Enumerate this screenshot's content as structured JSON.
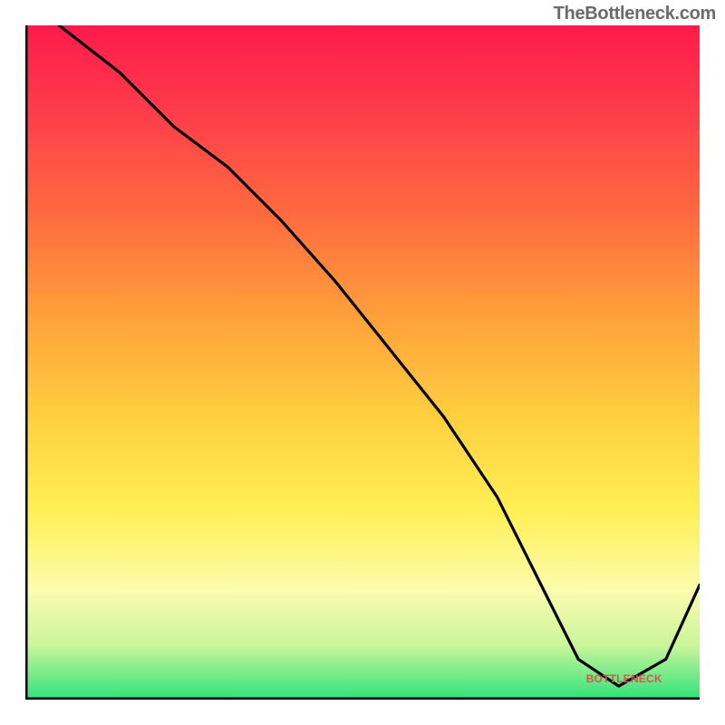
{
  "attribution": "TheBottleneck.com",
  "chart_data": {
    "type": "line",
    "title": "",
    "xlabel": "",
    "ylabel": "",
    "xlim": [
      0,
      100
    ],
    "ylim": [
      0,
      100
    ],
    "grid": false,
    "legend": false,
    "background_gradient_from_top": [
      "#ff1744",
      "#ff4d4d",
      "#ff8a3d",
      "#ffb347",
      "#ffd84a",
      "#fff176",
      "#fff9c4",
      "#d4f7b0",
      "#48e07a"
    ],
    "series": [
      {
        "name": "bottleneck-curve",
        "x": [
          5,
          14,
          22,
          30,
          38,
          46,
          54,
          62,
          70,
          76,
          82,
          88,
          95,
          100
        ],
        "y": [
          100,
          93,
          85,
          79,
          71,
          62,
          52,
          42,
          30,
          18,
          6,
          2,
          6,
          17
        ]
      }
    ],
    "series_label": "BOTTLENECK",
    "colors": {
      "axis": "#000000",
      "curve": "#000000",
      "badge": "#e05050"
    }
  }
}
